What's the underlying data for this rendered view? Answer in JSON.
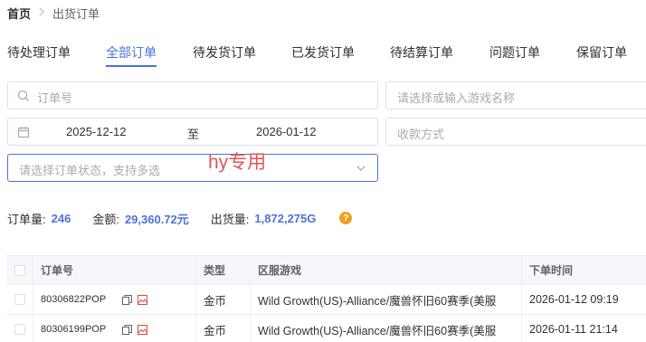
{
  "breadcrumb": {
    "home": "首页",
    "current": "出货订单"
  },
  "tabs": [
    {
      "label": "待处理订单",
      "active": false
    },
    {
      "label": "全部订单",
      "active": true
    },
    {
      "label": "待发货订单",
      "active": false
    },
    {
      "label": "已发货订单",
      "active": false
    },
    {
      "label": "待结算订单",
      "active": false
    },
    {
      "label": "问题订单",
      "active": false
    },
    {
      "label": "保留订单",
      "active": false
    }
  ],
  "filters": {
    "order_placeholder": "订单号",
    "game_placeholder": "请选择或输入游戏名称",
    "date_start": "2025-12-12",
    "date_separator": "至",
    "date_end": "2026-01-12",
    "payment_placeholder": "收款方式",
    "status_placeholder": "请选择订单状态，支持多选"
  },
  "overlay_text": "hy专用",
  "stats": {
    "order_count_label": "订单量:",
    "order_count": "246",
    "amount_label": "金额:",
    "amount": "29,360.72元",
    "shipped_label": "出货量:",
    "shipped": "1,872,275G",
    "help_icon": "?"
  },
  "table": {
    "headers": {
      "order": "订单号",
      "type": "类型",
      "game": "区服游戏",
      "time": "下单时间"
    },
    "rows": [
      {
        "order": "80306822POP",
        "type": "金币",
        "game": "Wild Growth(US)-Alliance/魔兽怀旧60赛季(美服",
        "time": "2026-01-12 09:19"
      },
      {
        "order": "80306199POP",
        "type": "金币",
        "game": "Wild Growth(US)-Alliance/魔兽怀旧60赛季(美服",
        "time": "2026-01-11 21:14"
      }
    ]
  },
  "colors": {
    "accent": "#4a72d9",
    "overlay": "#e05555",
    "help": "#f0a020"
  },
  "icons": {
    "search": "search-icon",
    "calendar": "calendar-icon",
    "chevron": "chevron-down-icon",
    "copy": "copy-icon",
    "image": "image-icon"
  }
}
